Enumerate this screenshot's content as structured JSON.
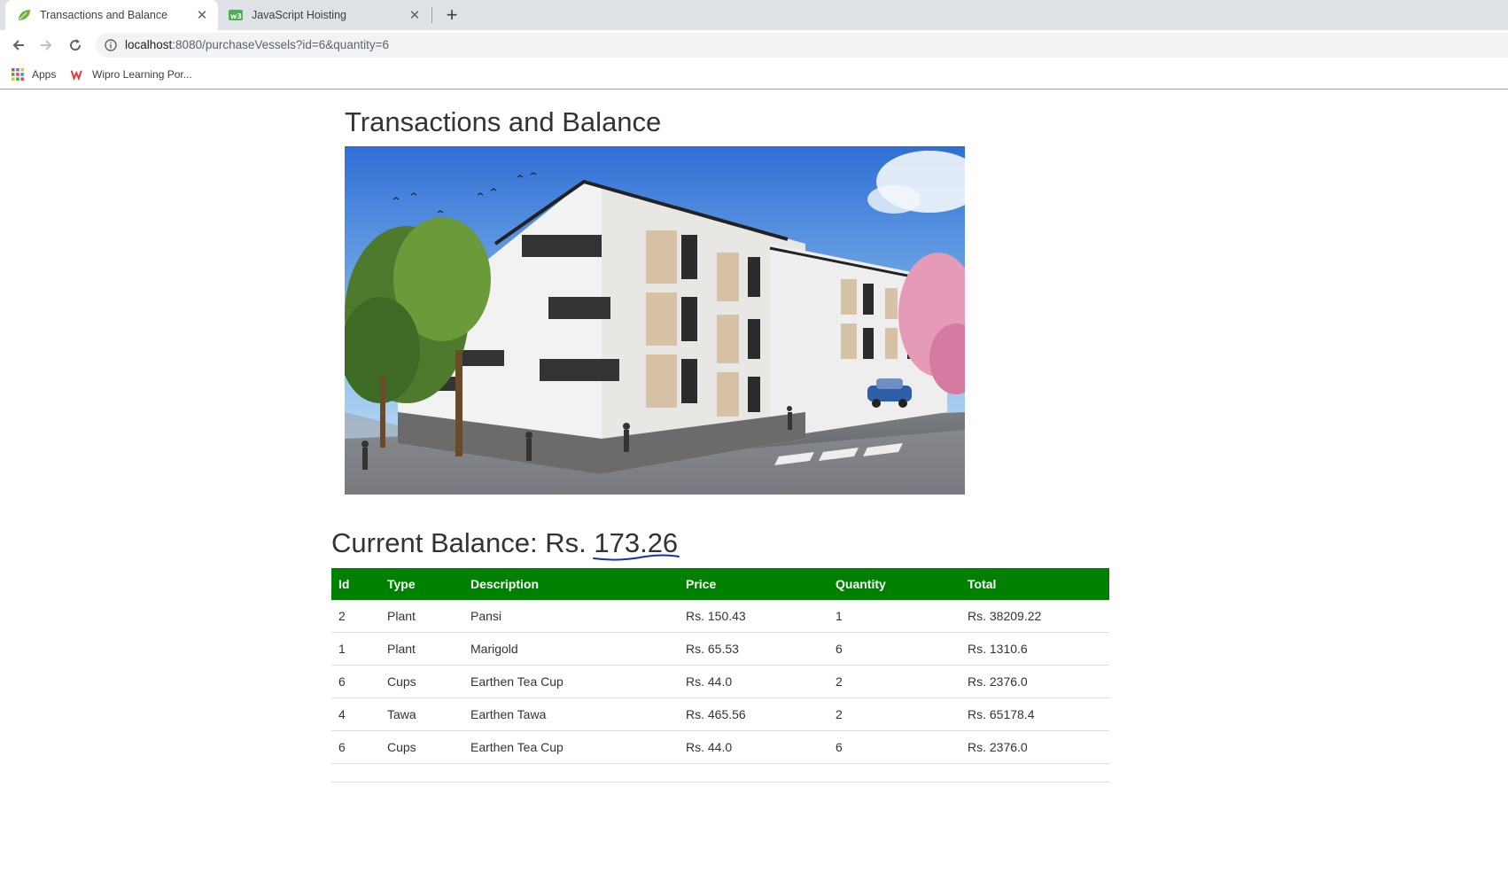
{
  "browser": {
    "tabs": [
      {
        "title": "Transactions and Balance",
        "active": true,
        "favicon": "leaf-icon"
      },
      {
        "title": "JavaScript Hoisting",
        "active": false,
        "favicon": "w3-icon"
      }
    ],
    "url_host": "localhost",
    "url_rest": ":8080/purchaseVessels?id=6&quantity=6",
    "bookmarks": [
      {
        "label": "Apps",
        "icon": "apps-grid-icon"
      },
      {
        "label": "Wipro Learning Por...",
        "icon": "wipro-logo-icon"
      }
    ]
  },
  "page": {
    "title": "Transactions and Balance",
    "balance_label": "Current Balance: Rs. ",
    "balance_value": "173.26",
    "table": {
      "headers": [
        "Id",
        "Type",
        "Description",
        "Price",
        "Quantity",
        "Total"
      ],
      "rows": [
        [
          "2",
          "Plant",
          "Pansi",
          "Rs. 150.43",
          "1",
          "Rs. 38209.22"
        ],
        [
          "1",
          "Plant",
          "Marigold",
          "Rs. 65.53",
          "6",
          "Rs. 1310.6"
        ],
        [
          "6",
          "Cups",
          "Earthen Tea Cup",
          "Rs. 44.0",
          "2",
          "Rs. 2376.0"
        ],
        [
          "4",
          "Tawa",
          "Earthen Tawa",
          "Rs. 465.56",
          "2",
          "Rs. 65178.4"
        ],
        [
          "6",
          "Cups",
          "Earthen Tea Cup",
          "Rs. 44.0",
          "6",
          "Rs. 2376.0"
        ]
      ]
    }
  },
  "colors": {
    "header_green": "#008000",
    "tabstrip": "#dee1e6",
    "text": "#333333"
  }
}
